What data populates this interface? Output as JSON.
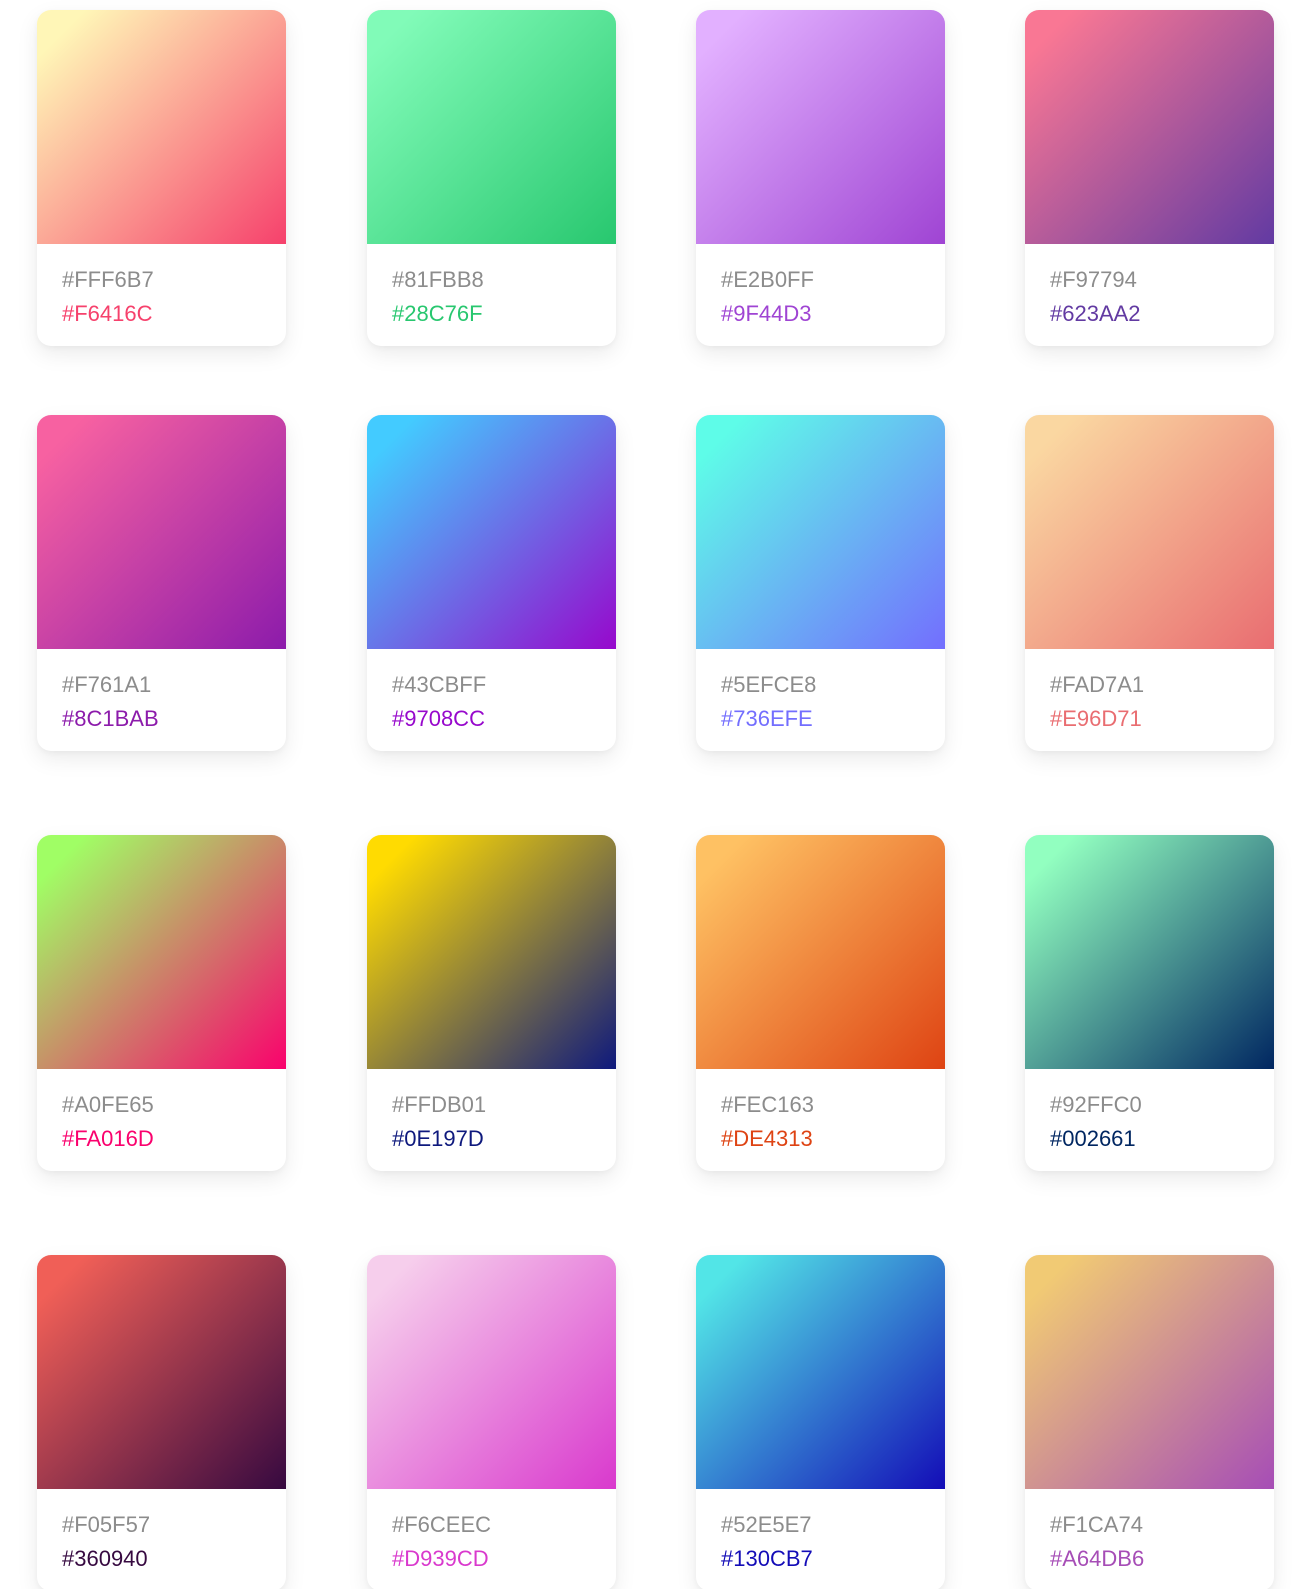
{
  "gradients": [
    {
      "from": "#FFF6B7",
      "to": "#F6416C"
    },
    {
      "from": "#81FBB8",
      "to": "#28C76F"
    },
    {
      "from": "#E2B0FF",
      "to": "#9F44D3"
    },
    {
      "from": "#F97794",
      "to": "#623AA2"
    },
    {
      "from": "#F761A1",
      "to": "#8C1BAB"
    },
    {
      "from": "#43CBFF",
      "to": "#9708CC"
    },
    {
      "from": "#5EFCE8",
      "to": "#736EFE"
    },
    {
      "from": "#FAD7A1",
      "to": "#E96D71"
    },
    {
      "from": "#A0FE65",
      "to": "#FA016D"
    },
    {
      "from": "#FFDB01",
      "to": "#0E197D"
    },
    {
      "from": "#FEC163",
      "to": "#DE4313"
    },
    {
      "from": "#92FFC0",
      "to": "#002661"
    },
    {
      "from": "#F05F57",
      "to": "#360940"
    },
    {
      "from": "#F6CEEC",
      "to": "#D939CD"
    },
    {
      "from": "#52E5E7",
      "to": "#130CB7"
    },
    {
      "from": "#F1CA74",
      "to": "#A64DB6"
    }
  ]
}
